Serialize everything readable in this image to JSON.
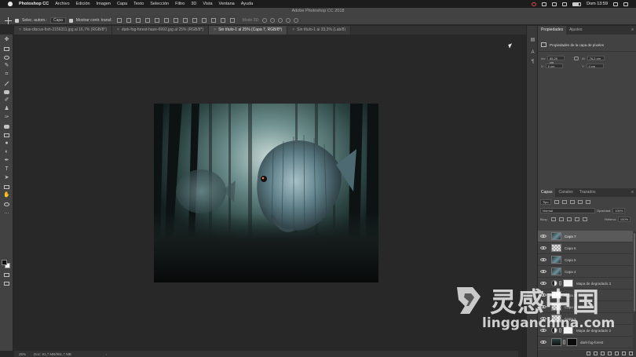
{
  "menubar": {
    "app_name": "Photoshop CC",
    "items": [
      "Archivo",
      "Edición",
      "Imagen",
      "Capa",
      "Texto",
      "Selección",
      "Filtro",
      "3D",
      "Vista",
      "Ventana",
      "Ayuda"
    ],
    "clock": "Dom 13:59"
  },
  "window_title": "Adobe Photoshop CC 2018",
  "options": {
    "auto_select_label": "Selec. autom.:",
    "auto_select_value": "Capa",
    "transform_label": "Mostrar contr. transf.",
    "mode_3d_label": "Modo 3D:"
  },
  "tabs": [
    {
      "label": "blue-discus-fish-2156311.jpg al 16,7% (RGB/8*)",
      "active": false
    },
    {
      "label": "dark-fog-forest-haze-6992.jpg al 25% (RGB/8*)",
      "active": false
    },
    {
      "label": "Sin título-1 al 25% (Capa 7, RGB/8*)",
      "active": true
    },
    {
      "label": "Sin título-1 al 33,3% (Lab/8)",
      "active": false
    }
  ],
  "status": {
    "zoom": "25%",
    "doc": "Doc: 91,7 MB/991,7 MB"
  },
  "properties": {
    "tabs": [
      "Propiedades",
      "Ajustes"
    ],
    "heading": "Propiedades de la capa de píxeles",
    "an_label": "An:",
    "an_value": "85,29 cm",
    "al_label": "Al:",
    "al_value": "76,2 cm",
    "x_label": "X:",
    "x_value": "0 cm",
    "y_label": "Y:",
    "y_value": "0 cm"
  },
  "layers_panel": {
    "tabs": [
      "Capas",
      "Canales",
      "Trazados"
    ],
    "filter_value": "Tipo",
    "blend_mode": "Normal",
    "opacity_label": "Opacidad:",
    "opacity_value": "100%",
    "lock_label": "Bloq.:",
    "fill_label": "Relleno:",
    "fill_value": "100%",
    "layers": [
      {
        "name": "Capa 7",
        "thumb": "fish",
        "selected": true
      },
      {
        "name": "Capa 6",
        "thumb": "check",
        "selected": false
      },
      {
        "name": "Capa 5",
        "thumb": "fish",
        "selected": false
      },
      {
        "name": "Capa 4",
        "thumb": "fish",
        "selected": false
      },
      {
        "name": "Mapa de degradado 3",
        "thumb": "white",
        "selected": false
      },
      {
        "name": "Capa 3",
        "thumb": "white",
        "selected": false
      },
      {
        "name": "Capa 2",
        "thumb": "check",
        "selected": false
      },
      {
        "name": "Capa 1",
        "thumb": "check",
        "selected": false
      },
      {
        "name": "Mapa de degradado 2",
        "thumb": "white",
        "selected": false
      },
      {
        "name": "dark-fog-forest",
        "thumb": "forest",
        "selected": false
      }
    ]
  },
  "watermark": {
    "cn": "灵感中国",
    "en": "lingganchina.com"
  },
  "colors": {
    "accent_red": "#d23b3b",
    "panel_bg": "#424242",
    "workspace_bg": "#282828"
  }
}
